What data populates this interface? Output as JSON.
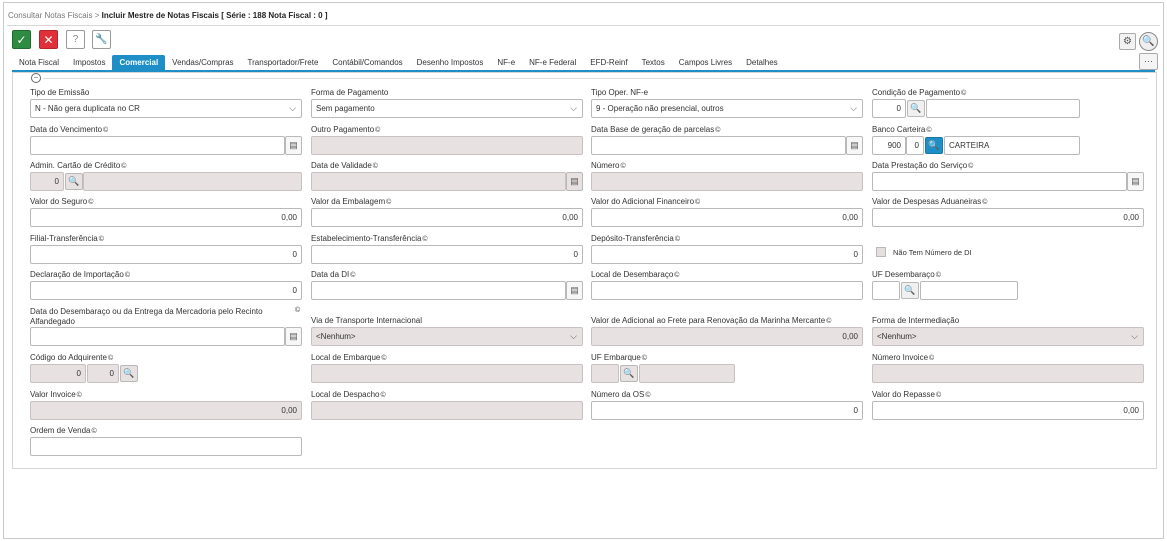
{
  "breadcrumb": {
    "parent": "Consultar Notas Fiscais",
    "separator": ">",
    "current": "Incluir Mestre de Notas Fiscais [ Série : 188 Nota Fiscal : 0 ]"
  },
  "toolbar": {
    "ok": "✓",
    "cancel": "✕",
    "help": "?",
    "tool": "🔧",
    "gear": "⚙",
    "search": "🔍",
    "more": "⋯"
  },
  "tabs": [
    "Nota Fiscal",
    "Impostos",
    "Comercial",
    "Vendas/Compras",
    "Transportador/Frete",
    "Contábil/Comandos",
    "Desenho Impostos",
    "NF-e",
    "NF-e Federal",
    "EFD-Reinf",
    "Textos",
    "Campos Livres",
    "Detalhes"
  ],
  "active_tab": "Comercial",
  "collapse": "−",
  "icons": {
    "copy": "©",
    "calendar": "▤",
    "search": "🔍",
    "chevron": "⌵"
  },
  "fields": {
    "tipo_emissao": {
      "label": "Tipo de Emissão",
      "value": "N - Não gera duplicata no CR"
    },
    "forma_pagamento": {
      "label": "Forma de Pagamento",
      "value": "Sem pagamento"
    },
    "tipo_oper": {
      "label": "Tipo Oper. NF-e",
      "value": "9 - Operação não presencial, outros"
    },
    "condicao_pagamento": {
      "label": "Condição de Pagamento",
      "code": "0",
      "desc": ""
    },
    "data_vencimento": {
      "label": "Data do Vencimento",
      "value": ""
    },
    "outro_pagamento": {
      "label": "Outro Pagamento",
      "value": ""
    },
    "data_base": {
      "label": "Data Base de geração de parcelas",
      "value": ""
    },
    "banco_carteira": {
      "label": "Banco Carteira",
      "bank": "900",
      "code": "0",
      "desc": "CARTEIRA"
    },
    "admin_cartao": {
      "label": "Admin. Cartão de Crédito",
      "code": "0",
      "desc": ""
    },
    "data_validade": {
      "label": "Data de Validade",
      "value": ""
    },
    "numero": {
      "label": "Número",
      "value": ""
    },
    "data_prestacao": {
      "label": "Data Prestação do Serviço",
      "value": ""
    },
    "valor_seguro": {
      "label": "Valor do Seguro",
      "value": "0,00"
    },
    "valor_embalagem": {
      "label": "Valor da Embalagem",
      "value": "0,00"
    },
    "valor_adicional_fin": {
      "label": "Valor do Adicional Financeiro",
      "value": "0,00"
    },
    "valor_desp_aduaneiras": {
      "label": "Valor de Despesas Aduaneiras",
      "value": "0,00"
    },
    "filial_transf": {
      "label": "Filial-Transferência",
      "value": "0"
    },
    "estab_transf": {
      "label": "Estabelecimento-Transferência",
      "value": "0"
    },
    "deposito_transf": {
      "label": "Depósito-Transferência",
      "value": "0"
    },
    "nao_tem_di": {
      "label": "Não Tem Número de DI"
    },
    "decl_importacao": {
      "label": "Declaração de Importação",
      "value": "0"
    },
    "data_di": {
      "label": "Data da DI",
      "value": ""
    },
    "local_desembaraco": {
      "label": "Local de Desembaraço",
      "value": ""
    },
    "uf_desembaraco": {
      "label": "UF Desembaraço",
      "value": ""
    },
    "data_desembaraco": {
      "label": "Data do Desembaraço ou da Entrega da Mercadoria pelo Recinto Alfandegado",
      "value": ""
    },
    "via_transporte": {
      "label": "Via de Transporte Internacional",
      "value": "<Nenhum>"
    },
    "valor_afrmm": {
      "label": "Valor de Adicional ao Frete para Renovação da Marinha Mercante",
      "value": "0,00"
    },
    "forma_intermediacao": {
      "label": "Forma de Intermediação",
      "value": "<Nenhum>"
    },
    "codigo_adquirente": {
      "label": "Código do Adquirente",
      "code1": "0",
      "code2": "0"
    },
    "local_embarque": {
      "label": "Local de Embarque",
      "value": ""
    },
    "uf_embarque": {
      "label": "UF Embarque",
      "value": ""
    },
    "numero_invoice": {
      "label": "Número Invoice",
      "value": ""
    },
    "valor_invoice": {
      "label": "Valor Invoice",
      "value": "0,00"
    },
    "local_despacho": {
      "label": "Local de Despacho",
      "value": ""
    },
    "numero_os": {
      "label": "Número da OS",
      "value": "0"
    },
    "valor_repasse": {
      "label": "Valor do Repasse",
      "value": "0,00"
    },
    "ordem_venda": {
      "label": "Ordem de Venda",
      "value": ""
    }
  }
}
